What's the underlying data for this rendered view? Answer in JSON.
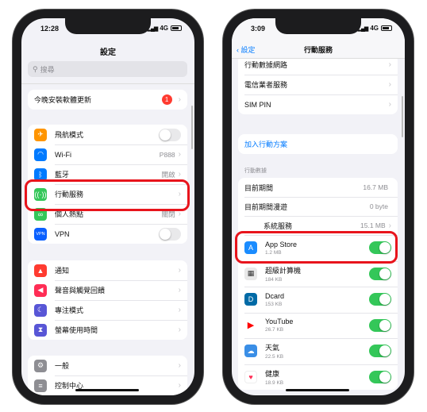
{
  "left": {
    "time": "12:28",
    "network": "4G",
    "title": "設定",
    "search_placeholder": "搜尋",
    "update": {
      "label": "今晚安裝軟體更新",
      "badge": "1"
    },
    "connectivity": [
      {
        "label": "飛航模式",
        "icon": "airplane-icon",
        "color": "#ff9500",
        "toggle": false
      },
      {
        "label": "Wi-Fi",
        "icon": "wifi-icon",
        "color": "#007aff",
        "value": "P888"
      },
      {
        "label": "藍牙",
        "icon": "bluetooth-icon",
        "color": "#007aff",
        "value": "開啟"
      },
      {
        "label": "行動服務",
        "icon": "cellular-icon",
        "color": "#34c759"
      },
      {
        "label": "個人熱點",
        "icon": "hotspot-icon",
        "color": "#34c759",
        "value": "關閉"
      },
      {
        "label": "VPN",
        "icon": "vpn-icon",
        "color": "#0a60ff",
        "toggle": false,
        "icon_text": "VPN"
      }
    ],
    "notifications": [
      {
        "label": "通知",
        "icon": "notification-icon",
        "color": "#ff3b30"
      },
      {
        "label": "聲音與觸覺回饋",
        "icon": "sound-icon",
        "color": "#ff2d55"
      },
      {
        "label": "專注模式",
        "icon": "moon-icon",
        "color": "#5856d6"
      },
      {
        "label": "螢幕使用時間",
        "icon": "hourglass-icon",
        "color": "#5856d6"
      }
    ],
    "general": [
      {
        "label": "一般",
        "icon": "gear-icon",
        "color": "#8e8e93"
      },
      {
        "label": "控制中心",
        "icon": "control-center-icon",
        "color": "#8e8e93"
      }
    ]
  },
  "right": {
    "time": "3:09",
    "network": "4G",
    "back": "設定",
    "title": "行動服務",
    "top": [
      {
        "label": "行動數據網路"
      },
      {
        "label": "電信業者服務"
      },
      {
        "label": "SIM PIN"
      }
    ],
    "add_plan": "加入行動方案",
    "section": "行動數據",
    "usage": [
      {
        "label": "目前期間",
        "value": "16.7 MB"
      },
      {
        "label": "目前期間漫遊",
        "value": "0 byte"
      },
      {
        "label": "系統服務",
        "value": "15.1 MB"
      }
    ],
    "apps": [
      {
        "name": "App Store",
        "size": "1.2 MB",
        "icon": "app-store-icon",
        "color": "#1a8cff",
        "toggle": true
      },
      {
        "name": "超級計算機",
        "size": "184 KB",
        "icon": "calculator-icon",
        "color": "#e8e8e8",
        "toggle": true
      },
      {
        "name": "Dcard",
        "size": "153 KB",
        "icon": "dcard-icon",
        "color": "#006aa6",
        "toggle": true
      },
      {
        "name": "YouTube",
        "size": "26.7 KB",
        "icon": "youtube-icon",
        "color": "#ff0000",
        "toggle": true
      },
      {
        "name": "天氣",
        "size": "22.5 KB",
        "icon": "weather-icon",
        "color": "#3a8ee6",
        "toggle": true
      },
      {
        "name": "健康",
        "size": "18.9 KB",
        "icon": "health-icon",
        "color": "#ff2d55",
        "toggle": true
      }
    ]
  }
}
